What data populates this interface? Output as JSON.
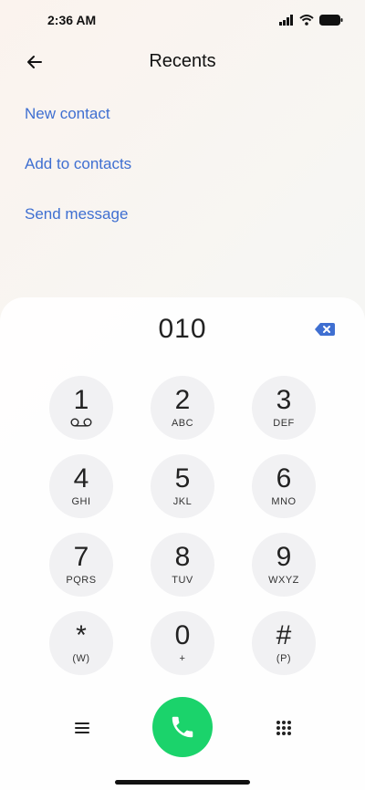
{
  "status_bar": {
    "time": "2:36 AM",
    "icons": [
      "signal-icon",
      "wifi-icon",
      "battery-icon"
    ]
  },
  "header": {
    "title": "Recents",
    "back_icon": "back-arrow-icon"
  },
  "actions": [
    {
      "label": "New contact"
    },
    {
      "label": "Add to contacts"
    },
    {
      "label": "Send message"
    }
  ],
  "dialer": {
    "number": "010",
    "backspace_icon": "backspace-icon",
    "keys": [
      {
        "digit": "1",
        "letters": "",
        "sub": "voicemail-icon"
      },
      {
        "digit": "2",
        "letters": "ABC"
      },
      {
        "digit": "3",
        "letters": "DEF"
      },
      {
        "digit": "4",
        "letters": "GHI"
      },
      {
        "digit": "5",
        "letters": "JKL"
      },
      {
        "digit": "6",
        "letters": "MNO"
      },
      {
        "digit": "7",
        "letters": "PQRS"
      },
      {
        "digit": "8",
        "letters": "TUV"
      },
      {
        "digit": "9",
        "letters": "WXYZ"
      },
      {
        "digit": "*",
        "letters": "(W)"
      },
      {
        "digit": "0",
        "letters": "+"
      },
      {
        "digit": "#",
        "letters": "(P)"
      }
    ]
  },
  "bottom_bar": {
    "menu_icon": "menu-icon",
    "call_icon": "phone-icon",
    "dialpad_icon": "dialpad-icon"
  },
  "colors": {
    "accent": "#3f6fd1",
    "call": "#1bd36b"
  }
}
